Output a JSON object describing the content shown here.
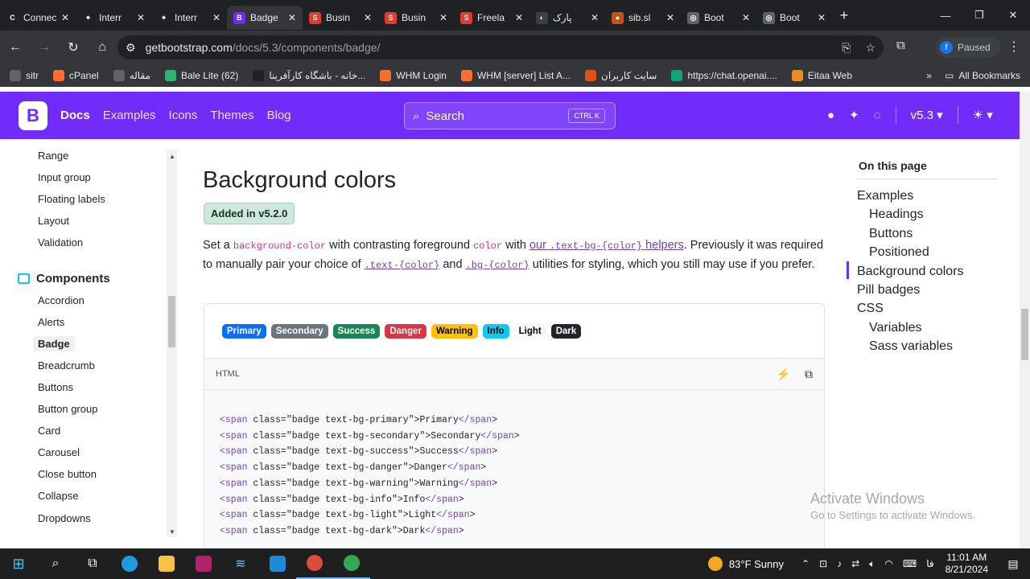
{
  "browser": {
    "tabs": [
      {
        "title": "Connect t",
        "icon": "C",
        "color": "#202124"
      },
      {
        "title": "Interr",
        "icon": "⌖",
        "color": "#202124"
      },
      {
        "title": "Interr",
        "icon": "⌖",
        "color": "#202124"
      },
      {
        "title": "Badge",
        "icon": "B",
        "color": "#712cf9",
        "active": true
      },
      {
        "title": "Busin",
        "icon": "S",
        "color": "#e03c31"
      },
      {
        "title": "Busin",
        "icon": "S",
        "color": "#e03c31"
      },
      {
        "title": "Freela",
        "icon": "S",
        "color": "#e03c31"
      },
      {
        "title": "پارک",
        "icon": "◐",
        "color": "#3c4043"
      },
      {
        "title": "sib.sl",
        "icon": "●",
        "color": "#c0551c"
      },
      {
        "title": "Boot",
        "icon": "◎",
        "color": "#5f6368"
      },
      {
        "title": "Boot",
        "icon": "◎",
        "color": "#5f6368"
      }
    ],
    "url_host": "getbootstrap.com",
    "url_path": "/docs/5.3/components/badge/",
    "profile_status": "Paused",
    "profile_initial": "f",
    "bookmarks": [
      {
        "label": "sitr",
        "color": "#5f6368"
      },
      {
        "label": "cPanel",
        "color": "#ff6c2c"
      },
      {
        "label": "مقاله",
        "color": "#5f6368"
      },
      {
        "label": "Bale Lite (62)",
        "color": "#2bb673"
      },
      {
        "label": "خانه - باشگاه کارآفرینا...",
        "color": "#202124"
      },
      {
        "label": "WHM Login",
        "color": "#ff6c2c"
      },
      {
        "label": "WHM [server] List A...",
        "color": "#ff6c2c"
      },
      {
        "label": "سایت کاربران",
        "color": "#e0501c"
      },
      {
        "label": "https://chat.openai....",
        "color": "#10a37f"
      },
      {
        "label": "Eitaa Web",
        "color": "#f08a24"
      }
    ],
    "all_bookmarks": "All Bookmarks"
  },
  "navbar": {
    "brand": "B",
    "links": [
      "Docs",
      "Examples",
      "Icons",
      "Themes",
      "Blog"
    ],
    "search_label": "Search",
    "search_kbd": "CTRL K",
    "version": "v5.3"
  },
  "sidebar": {
    "forms_items": [
      "Range",
      "Input group",
      "Floating labels",
      "Layout",
      "Validation"
    ],
    "components_title": "Components",
    "components_items": [
      "Accordion",
      "Alerts",
      "Badge",
      "Breadcrumb",
      "Buttons",
      "Button group",
      "Card",
      "Carousel",
      "Close button",
      "Collapse",
      "Dropdowns"
    ],
    "active": "Badge"
  },
  "content": {
    "title": "Background colors",
    "added_badge": "Added in v5.2.0",
    "lead_1": "Set a ",
    "lead_code_1": "background-color",
    "lead_2": " with contrasting foreground ",
    "lead_code_2": "color",
    "lead_3": " with ",
    "lead_link_1": "our ",
    "lead_link_code": ".text-bg-{color}",
    "lead_link_2": " helpers",
    "lead_4": ". Previously it was required to manually pair your choice of ",
    "lead_code_3": ".text-{color}",
    "lead_5": " and ",
    "lead_code_4": ".bg-{color}",
    "lead_6": " utilities for styling, which you still may use if you prefer.",
    "badges": [
      {
        "label": "Primary",
        "bg": "#0d6efd",
        "fg": "#ffffff"
      },
      {
        "label": "Secondary",
        "bg": "#6c757d",
        "fg": "#ffffff"
      },
      {
        "label": "Success",
        "bg": "#198754",
        "fg": "#ffffff"
      },
      {
        "label": "Danger",
        "bg": "#dc3545",
        "fg": "#ffffff"
      },
      {
        "label": "Warning",
        "bg": "#ffc107",
        "fg": "#000000"
      },
      {
        "label": "Info",
        "bg": "#0dcaf0",
        "fg": "#000000"
      },
      {
        "label": "Light",
        "bg": "#f8f9fa",
        "fg": "#000000"
      },
      {
        "label": "Dark",
        "bg": "#212529",
        "fg": "#ffffff"
      }
    ],
    "code_lang": "HTML",
    "code_lines": [
      "<span class=\"badge text-bg-primary\">Primary</span>",
      "<span class=\"badge text-bg-secondary\">Secondary</span>",
      "<span class=\"badge text-bg-success\">Success</span>",
      "<span class=\"badge text-bg-danger\">Danger</span>",
      "<span class=\"badge text-bg-warning\">Warning</span>",
      "<span class=\"badge text-bg-info\">Info</span>",
      "<span class=\"badge text-bg-light\">Light</span>",
      "<span class=\"badge text-bg-dark\">Dark</span>"
    ]
  },
  "toc": {
    "title": "On this page",
    "items": [
      {
        "label": "Examples",
        "level": 1
      },
      {
        "label": "Headings",
        "level": 2
      },
      {
        "label": "Buttons",
        "level": 2
      },
      {
        "label": "Positioned",
        "level": 2
      },
      {
        "label": "Background colors",
        "level": 1,
        "active": true
      },
      {
        "label": "Pill badges",
        "level": 1
      },
      {
        "label": "CSS",
        "level": 1
      },
      {
        "label": "Variables",
        "level": 2
      },
      {
        "label": "Sass variables",
        "level": 2
      }
    ]
  },
  "watermark": {
    "line1": "Activate Windows",
    "line2": "Go to Settings to activate Windows."
  },
  "taskbar": {
    "weather": "83°F  Sunny",
    "time": "11:01 AM",
    "date": "8/21/2024",
    "lang": "فا"
  }
}
